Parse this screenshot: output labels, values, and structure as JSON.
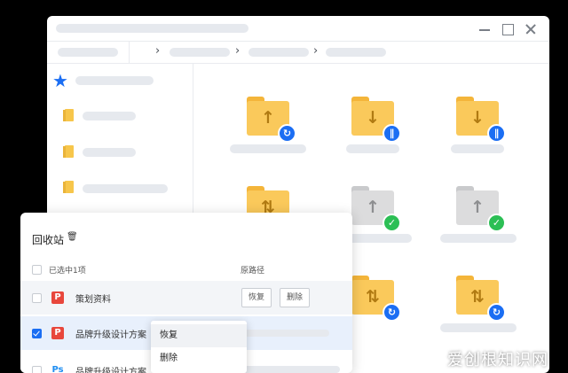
{
  "recycle_bin": {
    "title": "回收站",
    "trash_icon": "trash-icon",
    "selected_count": "已选中1项",
    "original_path_header": "原路径",
    "files": [
      {
        "name": "策划资料",
        "type_icon": "P",
        "checked": false,
        "actions": [
          "恢复",
          "删除"
        ]
      },
      {
        "name": "品牌升级设计方案",
        "type_icon": "P",
        "checked": true
      },
      {
        "name": "品牌升级设计方案",
        "type_icon": "Ps",
        "checked": false
      }
    ]
  },
  "context_menu": {
    "items": [
      "恢复",
      "删除"
    ]
  },
  "watermark": "爱创根知识网",
  "colors": {
    "accent": "#1b6ef3",
    "folder": "#fac95b",
    "success": "#2cbf55",
    "danger": "#e8473c"
  },
  "icons": {
    "window": [
      "minimize-icon",
      "maximize-icon",
      "close-icon"
    ],
    "folders": [
      {
        "state": "upload",
        "badge": "sync"
      },
      {
        "state": "download",
        "badge": "pause"
      },
      {
        "state": "download",
        "badge": "pause"
      },
      {
        "state": "transfer",
        "badge": "none"
      },
      {
        "state": "upload-done",
        "badge": "check"
      },
      {
        "state": "upload-done",
        "badge": "check"
      },
      {
        "state": "transfer",
        "badge": "sync"
      },
      {
        "state": "transfer",
        "badge": "sync"
      }
    ]
  }
}
